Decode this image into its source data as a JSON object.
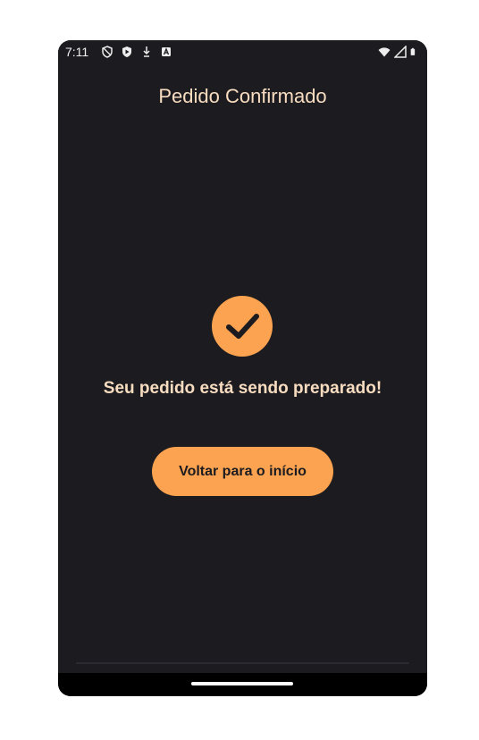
{
  "status_bar": {
    "time": "7:11",
    "left_icons": [
      "vpn-shield-icon",
      "play-protect-icon",
      "download-icon",
      "a-notification-icon"
    ],
    "right_icons": [
      "wifi-icon",
      "signal-icon",
      "battery-icon"
    ]
  },
  "app_bar": {
    "title": "Pedido Confirmado"
  },
  "main": {
    "icon": "check-circle-icon",
    "message": "Seu pedido está sendo preparado!",
    "button_label": "Voltar para o início"
  },
  "colors": {
    "background": "#1c1b1f",
    "accent": "#fba350",
    "text": "#f7dcc0"
  }
}
